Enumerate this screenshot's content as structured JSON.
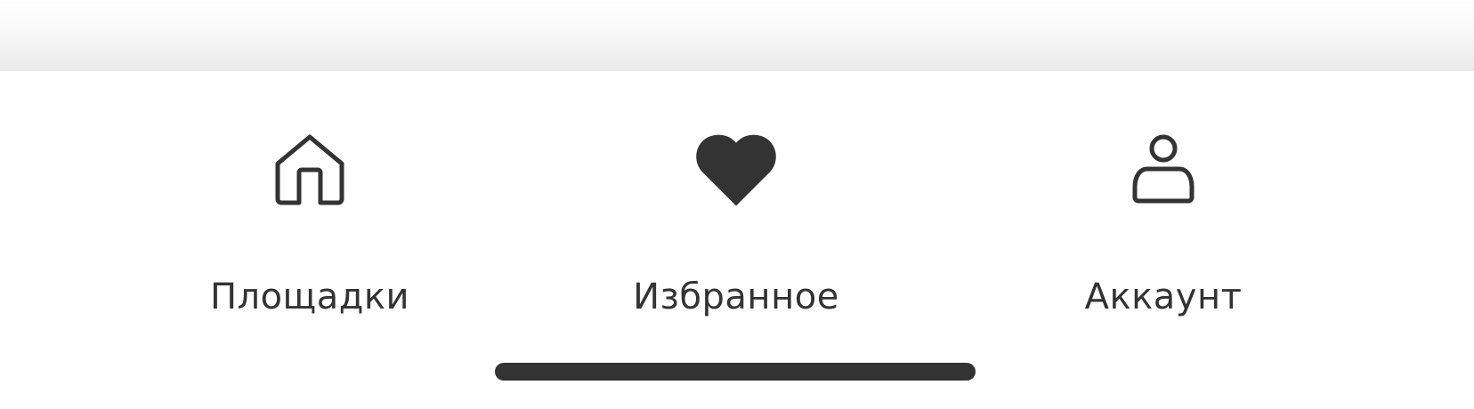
{
  "tabs": [
    {
      "id": "venues",
      "label": "Площадки",
      "icon": "home-icon",
      "active": false
    },
    {
      "id": "favorites",
      "label": "Избранное",
      "icon": "heart-icon",
      "active": true
    },
    {
      "id": "account",
      "label": "Аккаунт",
      "icon": "user-icon",
      "active": false
    }
  ],
  "colors": {
    "icon": "#333333",
    "label": "#333333",
    "background": "#ffffff",
    "home_indicator": "#333333"
  }
}
